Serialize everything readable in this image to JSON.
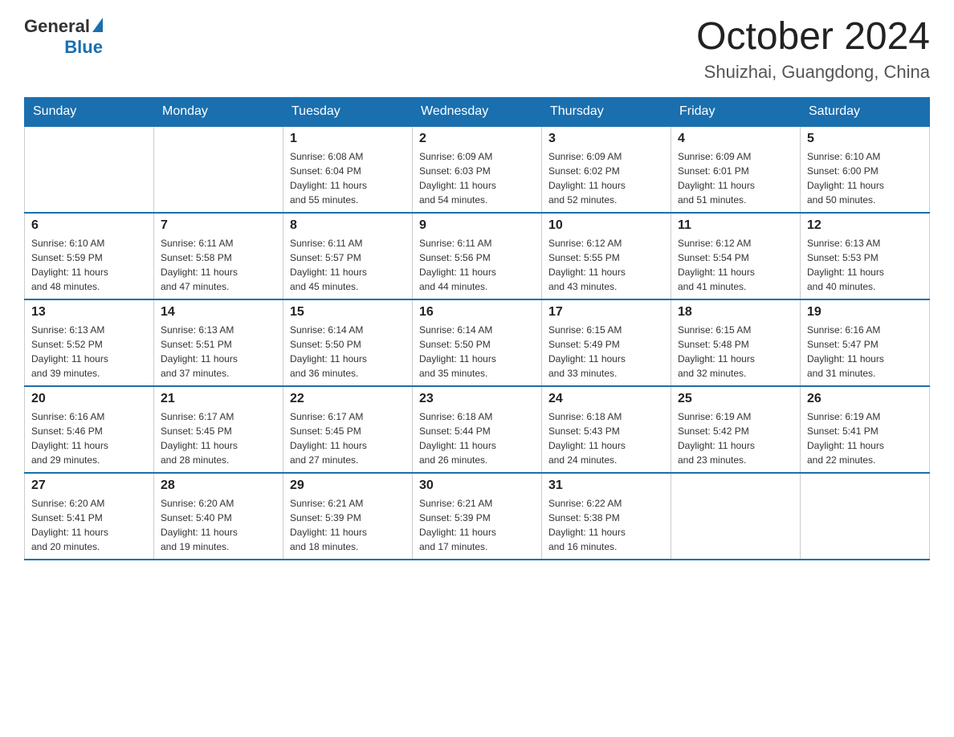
{
  "header": {
    "logo_general": "General",
    "logo_blue": "Blue",
    "month_title": "October 2024",
    "location": "Shuizhai, Guangdong, China"
  },
  "calendar": {
    "weekdays": [
      "Sunday",
      "Monday",
      "Tuesday",
      "Wednesday",
      "Thursday",
      "Friday",
      "Saturday"
    ],
    "weeks": [
      [
        {
          "day": "",
          "info": ""
        },
        {
          "day": "",
          "info": ""
        },
        {
          "day": "1",
          "info": "Sunrise: 6:08 AM\nSunset: 6:04 PM\nDaylight: 11 hours\nand 55 minutes."
        },
        {
          "day": "2",
          "info": "Sunrise: 6:09 AM\nSunset: 6:03 PM\nDaylight: 11 hours\nand 54 minutes."
        },
        {
          "day": "3",
          "info": "Sunrise: 6:09 AM\nSunset: 6:02 PM\nDaylight: 11 hours\nand 52 minutes."
        },
        {
          "day": "4",
          "info": "Sunrise: 6:09 AM\nSunset: 6:01 PM\nDaylight: 11 hours\nand 51 minutes."
        },
        {
          "day": "5",
          "info": "Sunrise: 6:10 AM\nSunset: 6:00 PM\nDaylight: 11 hours\nand 50 minutes."
        }
      ],
      [
        {
          "day": "6",
          "info": "Sunrise: 6:10 AM\nSunset: 5:59 PM\nDaylight: 11 hours\nand 48 minutes."
        },
        {
          "day": "7",
          "info": "Sunrise: 6:11 AM\nSunset: 5:58 PM\nDaylight: 11 hours\nand 47 minutes."
        },
        {
          "day": "8",
          "info": "Sunrise: 6:11 AM\nSunset: 5:57 PM\nDaylight: 11 hours\nand 45 minutes."
        },
        {
          "day": "9",
          "info": "Sunrise: 6:11 AM\nSunset: 5:56 PM\nDaylight: 11 hours\nand 44 minutes."
        },
        {
          "day": "10",
          "info": "Sunrise: 6:12 AM\nSunset: 5:55 PM\nDaylight: 11 hours\nand 43 minutes."
        },
        {
          "day": "11",
          "info": "Sunrise: 6:12 AM\nSunset: 5:54 PM\nDaylight: 11 hours\nand 41 minutes."
        },
        {
          "day": "12",
          "info": "Sunrise: 6:13 AM\nSunset: 5:53 PM\nDaylight: 11 hours\nand 40 minutes."
        }
      ],
      [
        {
          "day": "13",
          "info": "Sunrise: 6:13 AM\nSunset: 5:52 PM\nDaylight: 11 hours\nand 39 minutes."
        },
        {
          "day": "14",
          "info": "Sunrise: 6:13 AM\nSunset: 5:51 PM\nDaylight: 11 hours\nand 37 minutes."
        },
        {
          "day": "15",
          "info": "Sunrise: 6:14 AM\nSunset: 5:50 PM\nDaylight: 11 hours\nand 36 minutes."
        },
        {
          "day": "16",
          "info": "Sunrise: 6:14 AM\nSunset: 5:50 PM\nDaylight: 11 hours\nand 35 minutes."
        },
        {
          "day": "17",
          "info": "Sunrise: 6:15 AM\nSunset: 5:49 PM\nDaylight: 11 hours\nand 33 minutes."
        },
        {
          "day": "18",
          "info": "Sunrise: 6:15 AM\nSunset: 5:48 PM\nDaylight: 11 hours\nand 32 minutes."
        },
        {
          "day": "19",
          "info": "Sunrise: 6:16 AM\nSunset: 5:47 PM\nDaylight: 11 hours\nand 31 minutes."
        }
      ],
      [
        {
          "day": "20",
          "info": "Sunrise: 6:16 AM\nSunset: 5:46 PM\nDaylight: 11 hours\nand 29 minutes."
        },
        {
          "day": "21",
          "info": "Sunrise: 6:17 AM\nSunset: 5:45 PM\nDaylight: 11 hours\nand 28 minutes."
        },
        {
          "day": "22",
          "info": "Sunrise: 6:17 AM\nSunset: 5:45 PM\nDaylight: 11 hours\nand 27 minutes."
        },
        {
          "day": "23",
          "info": "Sunrise: 6:18 AM\nSunset: 5:44 PM\nDaylight: 11 hours\nand 26 minutes."
        },
        {
          "day": "24",
          "info": "Sunrise: 6:18 AM\nSunset: 5:43 PM\nDaylight: 11 hours\nand 24 minutes."
        },
        {
          "day": "25",
          "info": "Sunrise: 6:19 AM\nSunset: 5:42 PM\nDaylight: 11 hours\nand 23 minutes."
        },
        {
          "day": "26",
          "info": "Sunrise: 6:19 AM\nSunset: 5:41 PM\nDaylight: 11 hours\nand 22 minutes."
        }
      ],
      [
        {
          "day": "27",
          "info": "Sunrise: 6:20 AM\nSunset: 5:41 PM\nDaylight: 11 hours\nand 20 minutes."
        },
        {
          "day": "28",
          "info": "Sunrise: 6:20 AM\nSunset: 5:40 PM\nDaylight: 11 hours\nand 19 minutes."
        },
        {
          "day": "29",
          "info": "Sunrise: 6:21 AM\nSunset: 5:39 PM\nDaylight: 11 hours\nand 18 minutes."
        },
        {
          "day": "30",
          "info": "Sunrise: 6:21 AM\nSunset: 5:39 PM\nDaylight: 11 hours\nand 17 minutes."
        },
        {
          "day": "31",
          "info": "Sunrise: 6:22 AM\nSunset: 5:38 PM\nDaylight: 11 hours\nand 16 minutes."
        },
        {
          "day": "",
          "info": ""
        },
        {
          "day": "",
          "info": ""
        }
      ]
    ]
  }
}
